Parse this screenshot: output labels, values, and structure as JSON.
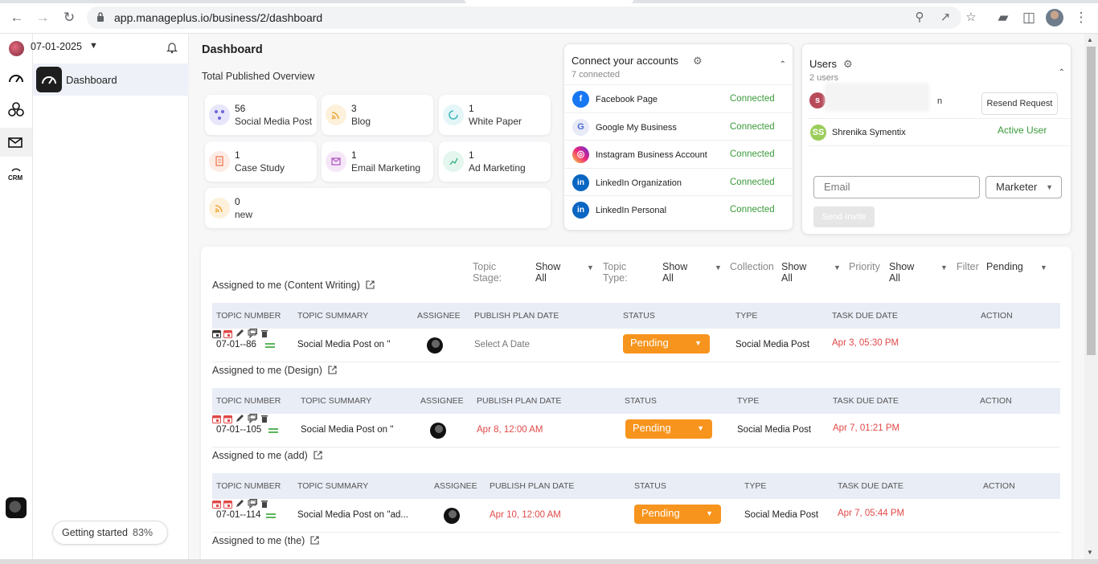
{
  "browser": {
    "url": "app.manageplus.io/business/2/dashboard",
    "nav_icons": [
      "back-icon",
      "forward-icon",
      "reload-icon"
    ],
    "toolbar_icons": [
      "zoom-icon",
      "share-icon",
      "star-icon",
      "extensions-icon",
      "sidepanel-icon",
      "profile-avatar",
      "menu-icon"
    ]
  },
  "sidebar": {
    "date": "07-01-2025",
    "nav_label": "Dashboard",
    "getting_started": "Getting started",
    "getting_started_pct": "83%"
  },
  "page": {
    "title": "Dashboard",
    "subtitle": "Total Published Overview"
  },
  "stats": [
    {
      "count": "56",
      "label": "Social Media Post",
      "icon": "social-icon",
      "color": "#e7e6fb"
    },
    {
      "count": "3",
      "label": "Blog",
      "icon": "rss-icon",
      "color": "#fdf1dc"
    },
    {
      "count": "1",
      "label": "White Paper",
      "icon": "swirl-icon",
      "color": "#e4f6f7"
    },
    {
      "count": "1",
      "label": "Case Study",
      "icon": "document-icon",
      "color": "#fdece6"
    },
    {
      "count": "1",
      "label": "Email Marketing",
      "icon": "mail-icon",
      "color": "#f6e7f8"
    },
    {
      "count": "1",
      "label": "Ad Marketing",
      "icon": "chart-icon",
      "color": "#e4f6ee"
    },
    {
      "count": "0",
      "label": "new",
      "icon": "rss-icon",
      "color": "#fdf1dc"
    }
  ],
  "accounts": {
    "title": "Connect your accounts",
    "subtitle": "7 connected",
    "items": [
      {
        "name": "Facebook Page",
        "status": "Connected",
        "color": "#1877f2",
        "glyph": "f"
      },
      {
        "name": "Google My Business",
        "status": "Connected",
        "color": "#4c6bd6",
        "glyph": "G"
      },
      {
        "name": "Instagram Business Account",
        "status": "Connected",
        "color": "#d6337f",
        "glyph": "◎"
      },
      {
        "name": "LinkedIn Organization",
        "status": "Connected",
        "color": "#0a66c2",
        "glyph": "in"
      },
      {
        "name": "LinkedIn Personal",
        "status": "Connected",
        "color": "#0a66c2",
        "glyph": "in"
      }
    ]
  },
  "users": {
    "title": "Users",
    "subtitle": "2 users",
    "user1_initial": "s",
    "user1_name_tail": "n",
    "resend_label": "Resend Request",
    "user2_initials": "SS",
    "user2_name": "Shrenika Symentix",
    "user2_status": "Active User",
    "email_placeholder": "Email",
    "role_value": "Marketer",
    "invite_label": "Send Invite"
  },
  "filters": [
    {
      "label": "Topic Stage:",
      "value": "Show All"
    },
    {
      "label": "Topic Type:",
      "value": "Show All"
    },
    {
      "label": "Collection",
      "value": "Show All"
    },
    {
      "label": "Priority",
      "value": "Show All"
    },
    {
      "label": "Filter",
      "value": "Pending"
    }
  ],
  "columns": [
    "TOPIC NUMBER",
    "TOPIC SUMMARY",
    "ASSIGNEE",
    "PUBLISH PLAN DATE",
    "STATUS",
    "TYPE",
    "TASK DUE DATE",
    "ACTION"
  ],
  "sections": [
    {
      "title": "Assigned to me (Content Writing)",
      "row": {
        "number": "07-01--86",
        "summary": "Social Media Post on ''",
        "publish": "Select A Date",
        "status": "Pending",
        "type": "Social Media Post",
        "due": "Apr 3, 05:30 PM"
      }
    },
    {
      "title": "Assigned to me (Design)",
      "row": {
        "number": "07-01--105",
        "summary": "Social Media Post on ''",
        "publish": "Apr 8, 12:00 AM",
        "status": "Pending",
        "type": "Social Media Post",
        "due": "Apr 7, 01:21 PM"
      }
    },
    {
      "title": "Assigned to me (add)",
      "row": {
        "number": "07-01--114",
        "summary": "Social Media Post on ''ad...",
        "publish": "Apr 10, 12:00 AM",
        "status": "Pending",
        "type": "Social Media Post",
        "due": "Apr 7, 05:44 PM"
      }
    },
    {
      "title": "Assigned to me (the)"
    }
  ]
}
